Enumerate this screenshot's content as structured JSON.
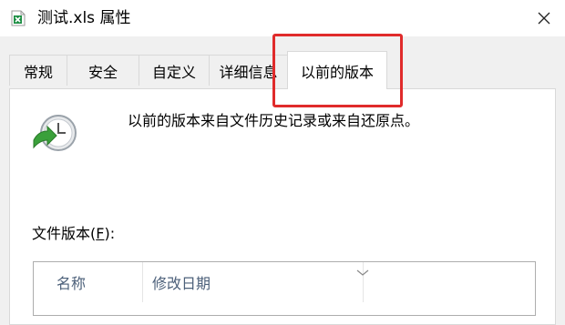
{
  "window": {
    "title": "测试.xls 属性",
    "file_icon": "excel-file-icon",
    "close_icon": "close-icon"
  },
  "tabs": [
    {
      "label": "常规",
      "active": false
    },
    {
      "label": "安全",
      "active": false
    },
    {
      "label": "自定义",
      "active": false
    },
    {
      "label": "详细信息",
      "active": false
    },
    {
      "label": "以前的版本",
      "active": true
    }
  ],
  "panel": {
    "icon": "file-history-icon",
    "description": "以前的版本来自文件历史记录或来自还原点。",
    "versions_label_text": "文件版本(",
    "versions_label_accel": "F",
    "versions_label_suffix": "):",
    "columns": [
      "名称",
      "修改日期"
    ]
  },
  "colors": {
    "highlight": "#e02b2b",
    "header_text": "#4c607a",
    "excel_green": "#1e8f45",
    "history_green": "#3aa03a"
  }
}
